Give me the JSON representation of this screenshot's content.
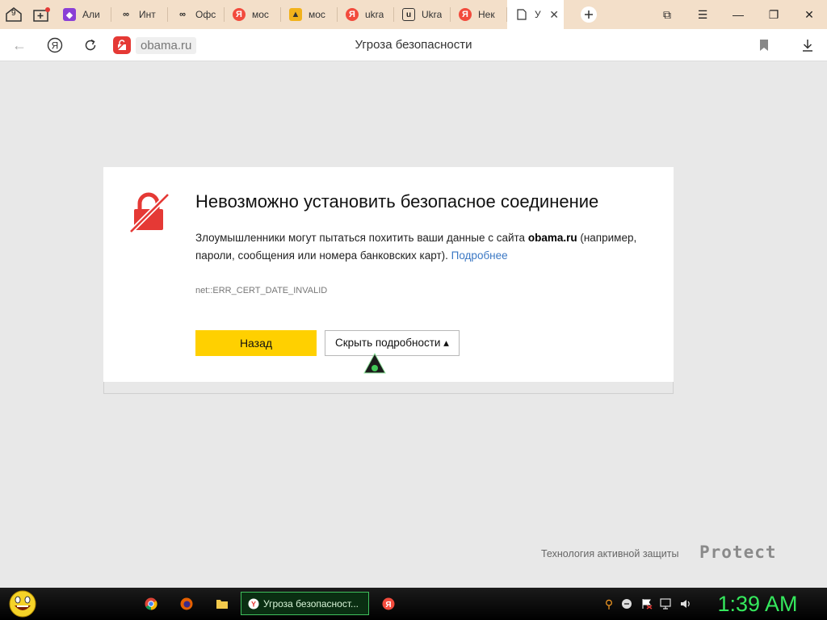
{
  "colors": {
    "accent_yellow": "#ffd000",
    "danger_red": "#e53935",
    "link_blue": "#3b78c4",
    "clock_green": "#35e85d",
    "tabstrip": "#f3dfc9"
  },
  "tabstrip": {
    "tab_count": "9",
    "tabs": [
      {
        "label": "Али",
        "icon": "purple-app-icon"
      },
      {
        "label": "Инт",
        "icon": "yandex-infinity-icon"
      },
      {
        "label": "Офс",
        "icon": "yandex-infinity-icon"
      },
      {
        "label": "мос",
        "icon": "yandex-red-icon"
      },
      {
        "label": "мос",
        "icon": "image-icon"
      },
      {
        "label": "ukra",
        "icon": "yandex-red-icon"
      },
      {
        "label": "Ukra",
        "icon": "uk-logo-icon"
      },
      {
        "label": "Нек",
        "icon": "yandex-red-icon"
      },
      {
        "label": "У",
        "icon": "page-icon",
        "active": true
      }
    ]
  },
  "addressbar": {
    "domain": "obama.ru",
    "page_title": "Угроза безопасности"
  },
  "error": {
    "heading": "Невозможно установить безопасное соединение",
    "desc_before": "Злоумышленники могут пытаться похитить ваши данные с сайта ",
    "desc_domain": "obama.ru",
    "desc_after": " (например, пароли, сообщения или номера банковских карт). ",
    "more_link": "Подробнее",
    "code": "net::ERR_CERT_DATE_INVALID",
    "back_button": "Назад",
    "details_button": "Скрыть подробности ▴"
  },
  "footer": {
    "text": "Технология активной защиты",
    "brand": "Protect"
  },
  "taskbar": {
    "active_window": "Угроза безопасност...",
    "clock": "1:39 AM"
  }
}
